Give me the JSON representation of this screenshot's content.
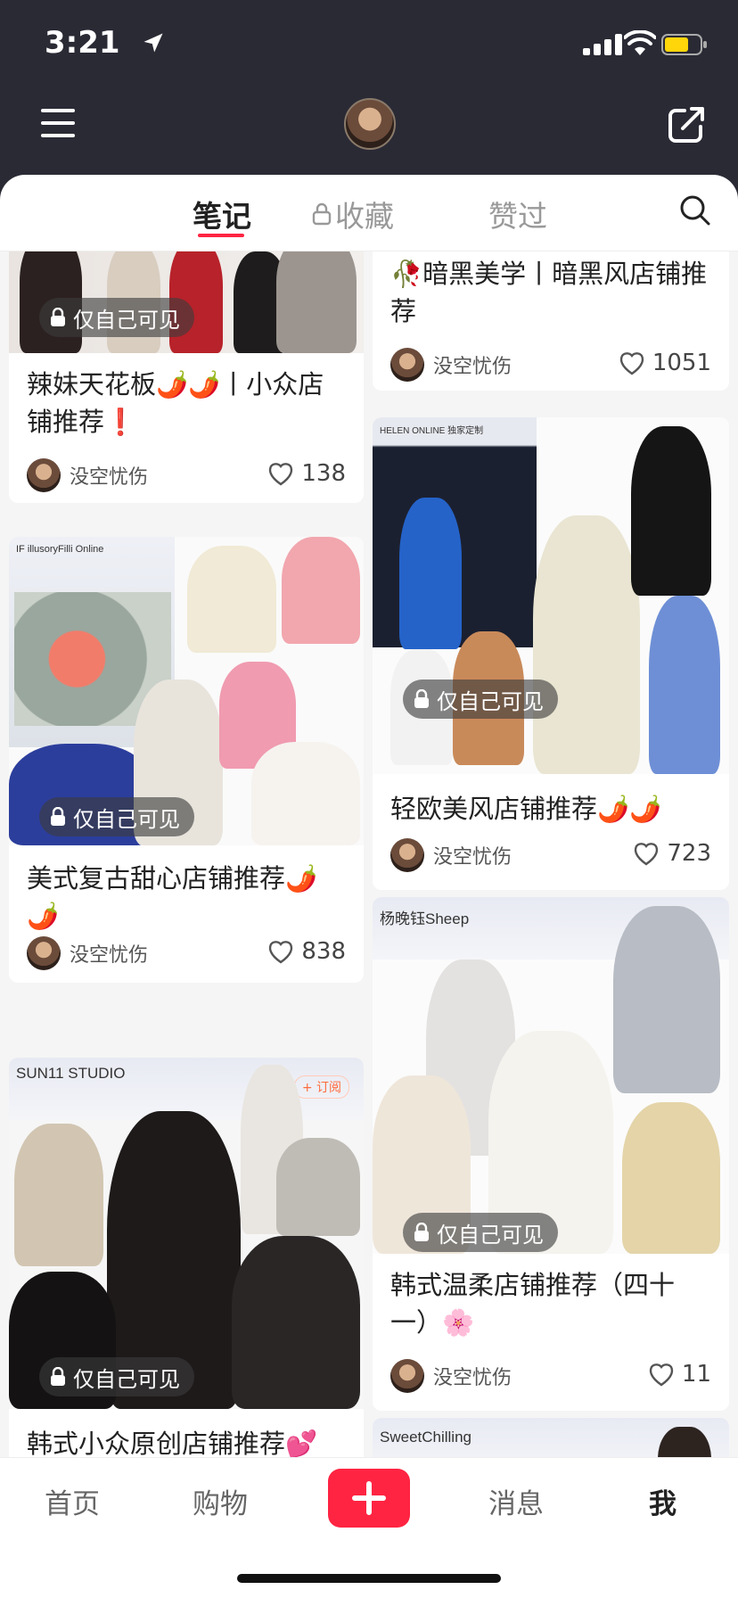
{
  "status_bar": {
    "time": "3:21"
  },
  "tabs": {
    "notes": "笔记",
    "favorites": "收藏",
    "liked": "赞过"
  },
  "badge_private": "仅自己可见",
  "cards": [
    {
      "title": "辣妹天花板🌶️🌶️丨小众店铺推荐❗",
      "author": "没空忧伤",
      "likes": "138"
    },
    {
      "title": "美式复古甜心店铺推荐🌶️🌶️",
      "author": "没空忧伤",
      "likes": "838",
      "shop": "IF illusoryFilli Online"
    },
    {
      "title": "韩式小众原创店铺推荐💕",
      "author": "没空忧伤",
      "shop": "SUN11 STUDIO",
      "shop_follow": "+ 订阅"
    },
    {
      "title": "🥀暗黑美学丨暗黑风店铺推荐",
      "author": "没空忧伤",
      "likes": "1051"
    },
    {
      "title": "轻欧美风店铺推荐🌶️🌶️",
      "author": "没空忧伤",
      "likes": "723",
      "shop": "HELEN ONLINE 独家定制"
    },
    {
      "title": "韩式温柔店铺推荐（四十一）🌸",
      "author": "没空忧伤",
      "likes": "11",
      "shop": "杨晚钰Sheep"
    },
    {
      "shop": "SweetChilling"
    }
  ],
  "bottom_nav": {
    "home": "首页",
    "shopping": "购物",
    "messages": "消息",
    "me": "我"
  }
}
